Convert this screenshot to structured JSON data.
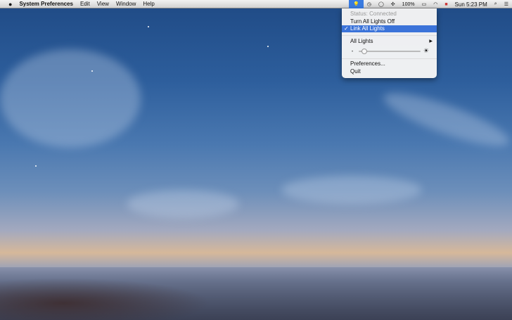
{
  "menubar": {
    "app": "System Preferences",
    "menus": [
      "Edit",
      "View",
      "Window",
      "Help"
    ],
    "battery": "100%",
    "clock": "Sun 5:23 PM"
  },
  "dropdown": {
    "status": "Status: Connected",
    "turn_off": "Turn All Lights Off",
    "link": "Link All Lights",
    "link_checked": true,
    "check": "✓",
    "all_lights": "All Lights",
    "brightness": 0.05,
    "preferences": "Preferences...",
    "quit": "Quit"
  }
}
